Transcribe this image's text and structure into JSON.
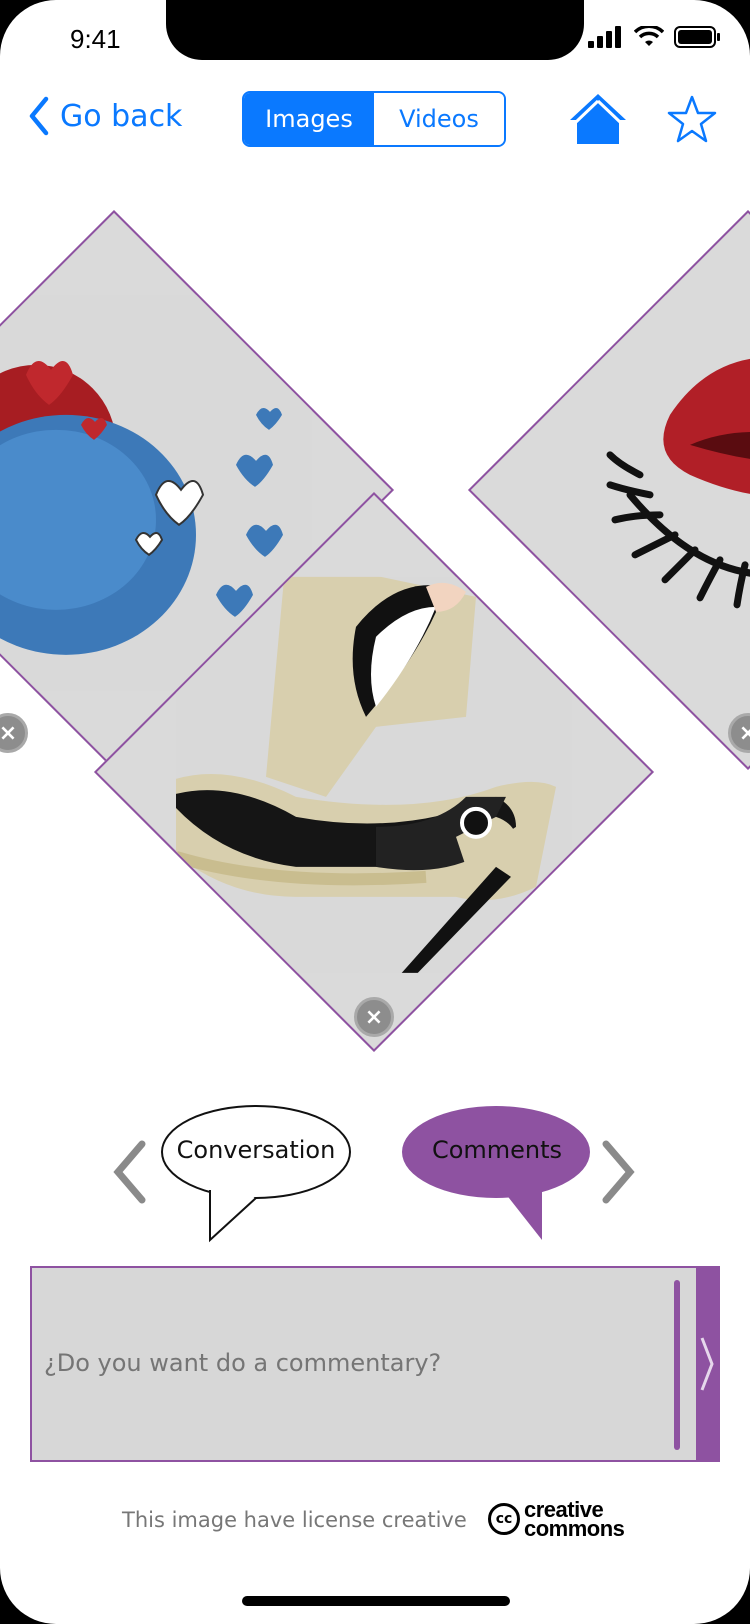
{
  "status_bar": {
    "time": "9:41"
  },
  "nav": {
    "back_label": "Go back",
    "segments": [
      {
        "label": "Images",
        "selected": true
      },
      {
        "label": "Videos",
        "selected": false
      }
    ],
    "accent_color": "#0a79ff"
  },
  "gallery": {
    "items": [
      {
        "name": "hearts-image",
        "close_label": "×"
      },
      {
        "name": "shoe-image",
        "close_label": "×"
      },
      {
        "name": "lips-image",
        "close_label": "×"
      }
    ],
    "frame_color": "#8e52a1"
  },
  "tabs": {
    "conversation_label": "Conversation",
    "comments_label": "Comments",
    "active_color": "#8e52a1"
  },
  "comment": {
    "placeholder": "¿Do you want do a commentary?"
  },
  "footer": {
    "license_text": "This image have license creative",
    "cc_badge": "cc",
    "cc_line1": "creative",
    "cc_line2": "commons"
  }
}
